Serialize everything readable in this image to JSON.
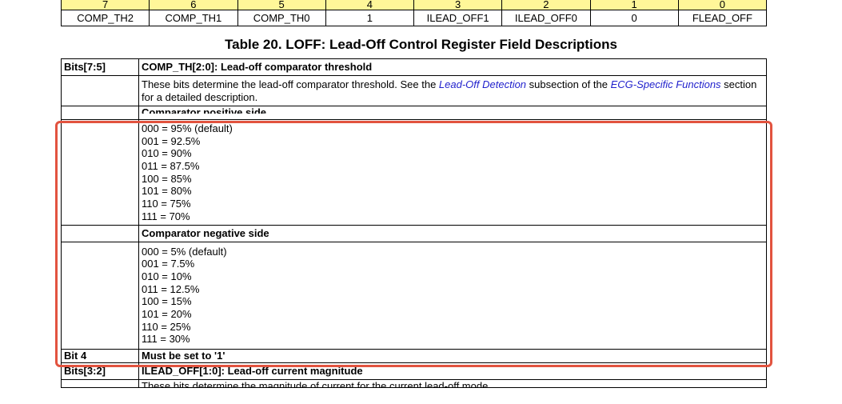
{
  "register": {
    "bit_numbers": [
      "7",
      "6",
      "5",
      "4",
      "3",
      "2",
      "1",
      "0"
    ],
    "field_names": [
      "COMP_TH2",
      "COMP_TH1",
      "COMP_TH0",
      "1",
      "ILEAD_OFF1",
      "ILEAD_OFF0",
      "0",
      "FLEAD_OFF"
    ],
    "header_color": "#fff799"
  },
  "caption": "Table 20. LOFF: Lead-Off Control Register Field Descriptions",
  "rows": {
    "bits_7_5": "Bits[7:5]",
    "comp_th_title": "COMP_TH[2:0]: Lead-off comparator threshold",
    "desc_part1": "These bits determine the lead-off comparator threshold. See the ",
    "desc_link1": "Lead-Off Detection",
    "desc_part2": " subsection of the ",
    "desc_link2": "ECG-Specific Functions",
    "desc_part3": " section for a detailed description.",
    "pos_title": "Comparator positive side",
    "pos_values": [
      "000 = 95% (default)",
      "001 = 92.5%",
      "010 = 90%",
      "011 = 87.5%",
      "100 = 85%",
      "101 = 80%",
      "110 = 75%",
      "111 = 70%"
    ],
    "neg_title": "Comparator negative side",
    "neg_values": [
      "000 = 5% (default)",
      "001 = 7.5%",
      "010 = 10%",
      "011 = 12.5%",
      "100 = 15%",
      "101 = 20%",
      "110 = 25%",
      "111 = 30%"
    ],
    "bit4_label": "Bit 4",
    "bit4_desc": "Must be set to '1'",
    "bits_3_2": "Bits[3:2]",
    "ilead_title": "ILEAD_OFF[1:0]: Lead-off current magnitude",
    "ilead_desc": "These bits determine the magnitude of current for the current lead-off mode."
  },
  "highlight_color": "#e2533f"
}
